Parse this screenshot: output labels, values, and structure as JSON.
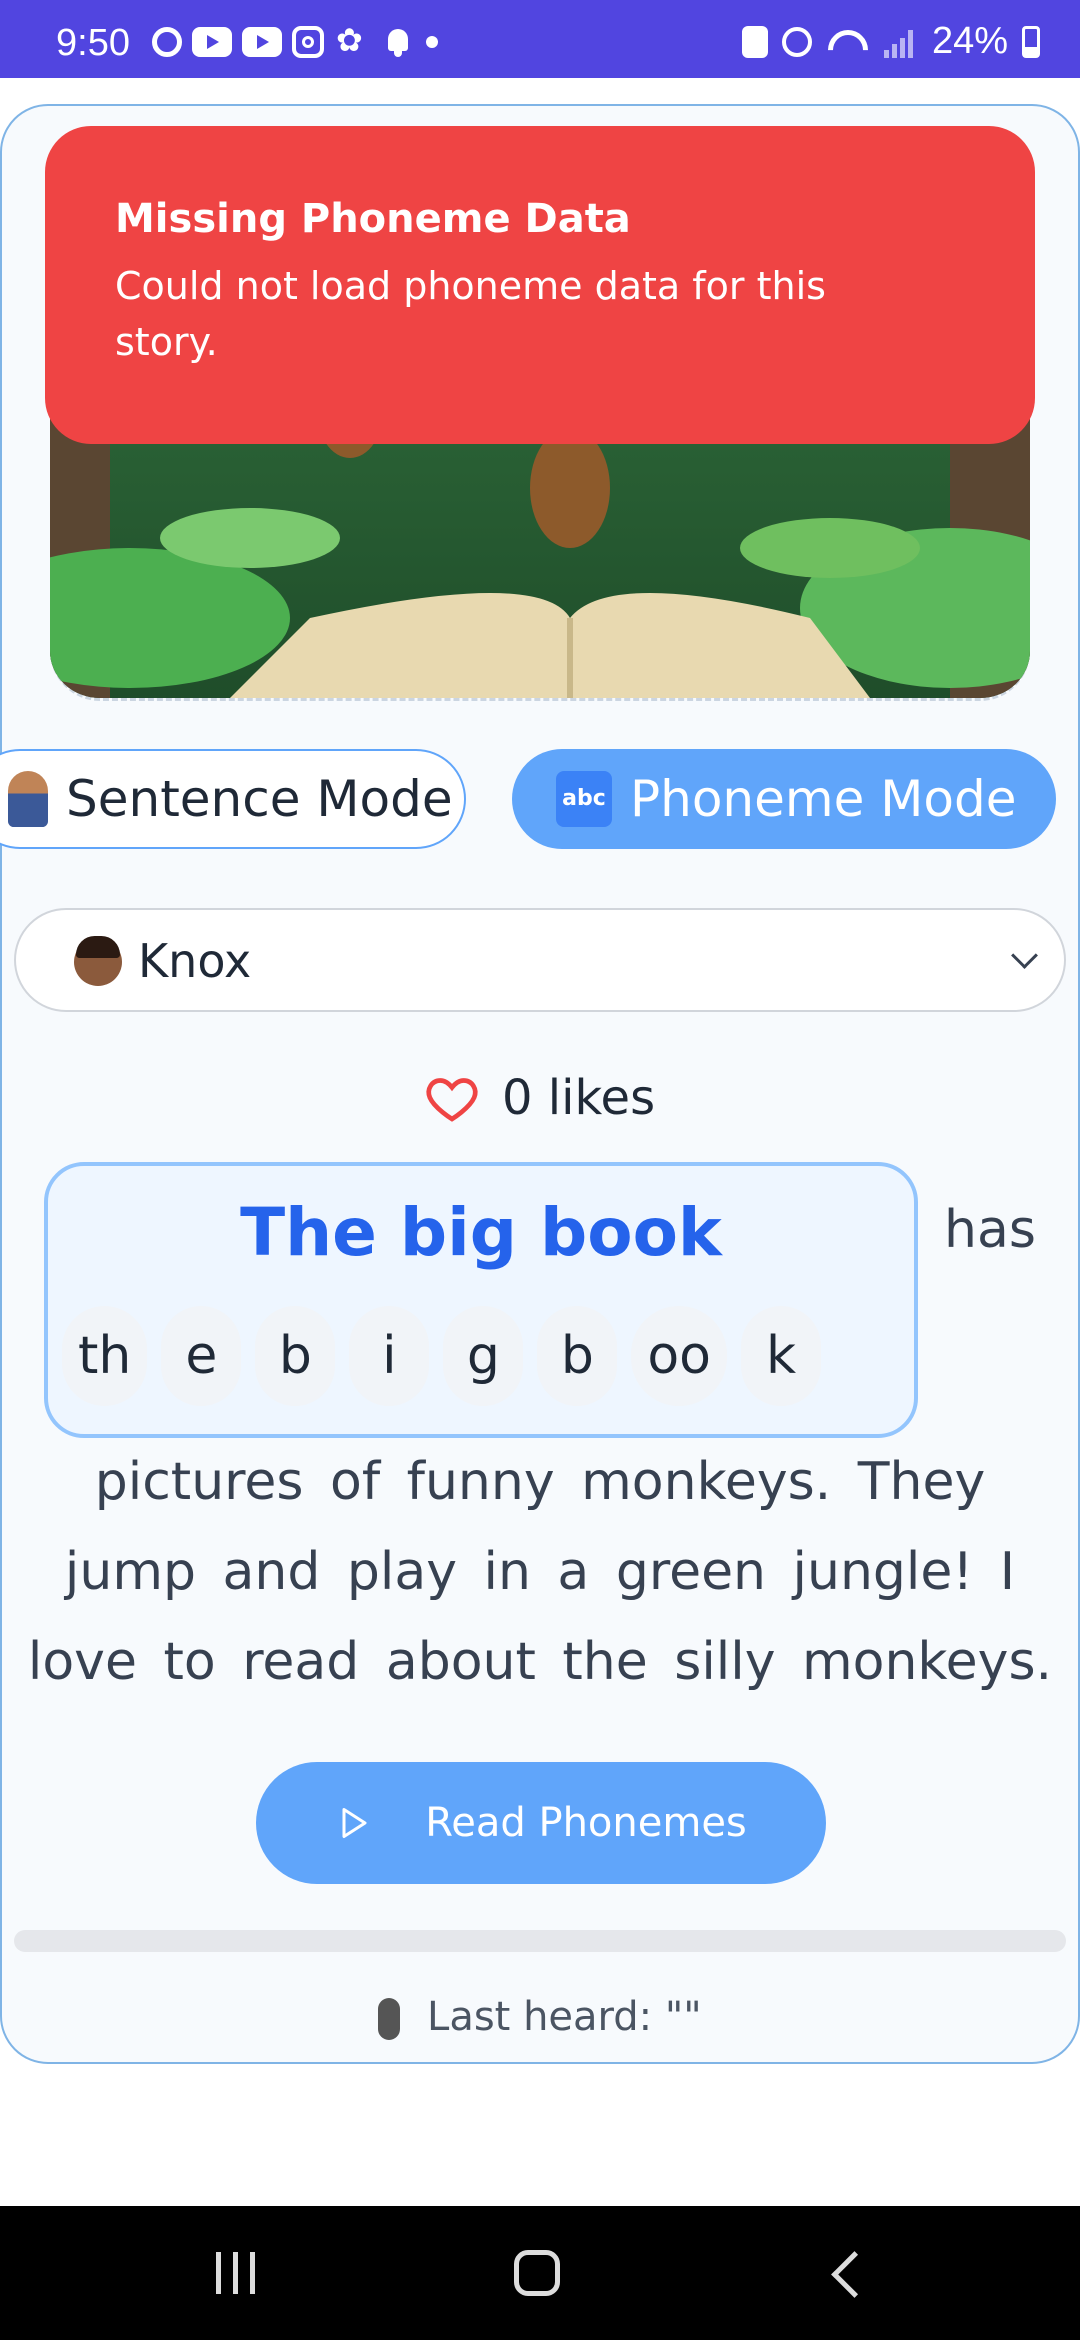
{
  "status_bar": {
    "time": "9:50",
    "battery": "24%"
  },
  "toast": {
    "title": "Missing Phoneme Data",
    "message": "Could not load phoneme data for this story."
  },
  "modes": {
    "sentence_label": "Sentence Mode",
    "phoneme_label": "Phoneme Mode",
    "phoneme_emoji": "abc",
    "active": "Phoneme Mode"
  },
  "voice": {
    "selected": "Knox"
  },
  "likes": {
    "text": "0 likes"
  },
  "story": {
    "highlighted_word": "The big book",
    "phonemes": [
      "th",
      "e",
      "b",
      "i",
      "g",
      "b",
      "oo",
      "k"
    ],
    "next_word": "has",
    "lines": [
      "pictures of funny monkeys. They",
      "jump and play in a green jungle! I",
      "love to read about the silly monkeys."
    ]
  },
  "read_button": {
    "label": "Read Phonemes"
  },
  "progress": {
    "fraction": 0
  },
  "last_heard": {
    "text": "Last heard: \"\""
  },
  "colors": {
    "accent": "#60a5fa",
    "error": "#ef4444",
    "highlight": "#2563eb",
    "status_bar": "#5145e0"
  }
}
